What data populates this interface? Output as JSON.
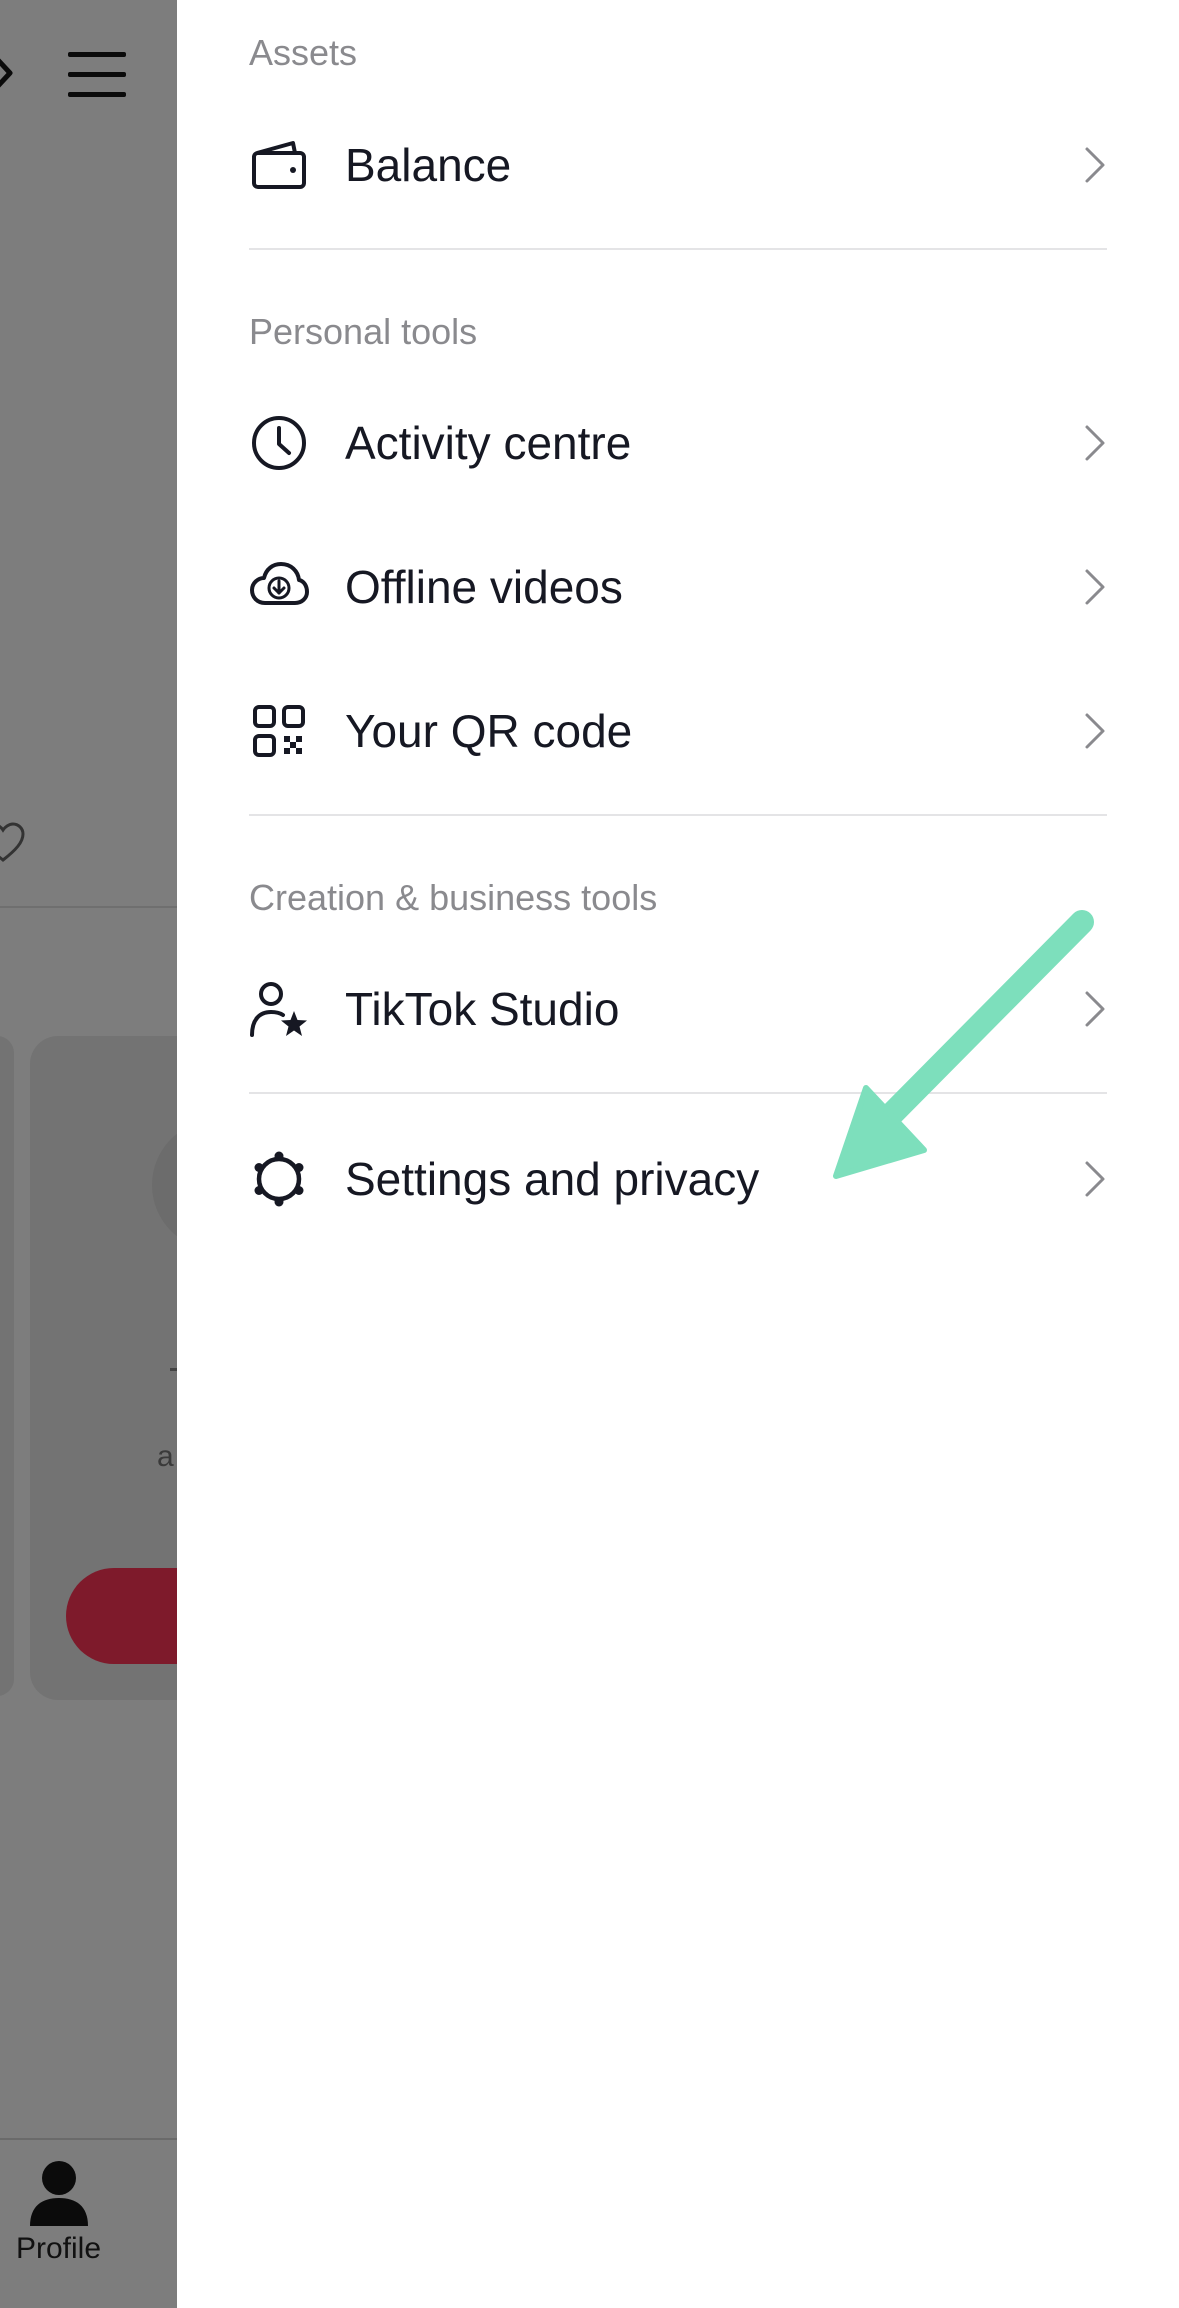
{
  "background": {
    "partial_text": "a",
    "tab_profile_label": "Profile"
  },
  "drawer": {
    "sections": [
      {
        "title": "Assets",
        "items": [
          {
            "label": "Balance",
            "icon": "wallet-icon"
          }
        ]
      },
      {
        "title": "Personal tools",
        "items": [
          {
            "label": "Activity centre",
            "icon": "clock-icon"
          },
          {
            "label": "Offline videos",
            "icon": "cloud-download-icon"
          },
          {
            "label": "Your QR code",
            "icon": "qr-code-icon"
          }
        ]
      },
      {
        "title": "Creation & business tools",
        "items": [
          {
            "label": "TikTok Studio",
            "icon": "person-star-icon"
          }
        ]
      },
      {
        "title": "",
        "items": [
          {
            "label": "Settings and privacy",
            "icon": "gear-icon"
          }
        ]
      }
    ]
  },
  "colors": {
    "overlay": "#7d7d7d",
    "text_primary": "#161823",
    "section_title": "#8a8a8e",
    "divider": "#e4e4e6",
    "annotation_arrow": "#7ddfbc",
    "dim_button": "#7e1a2b"
  }
}
